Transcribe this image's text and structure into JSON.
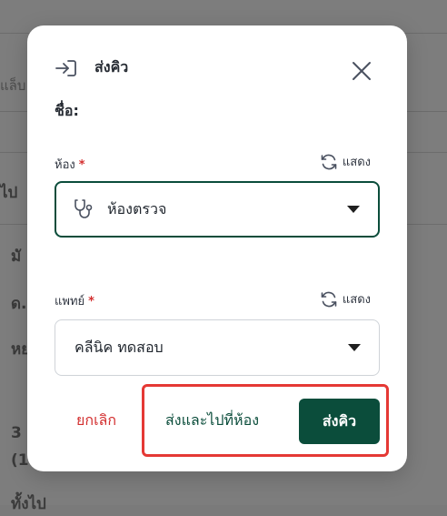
{
  "background": {
    "fragments": [
      "แล็บ",
      "ไป",
      "มั",
      "ด.",
      "หย",
      "3",
      "(1",
      "ทั้งไป"
    ]
  },
  "modal": {
    "title": "ส่งคิว",
    "name_label": "ชื่อ:",
    "room": {
      "label": "ห้อง",
      "required_mark": "*",
      "show_label": "แสดง",
      "value": "ห้องตรวจ"
    },
    "doctor": {
      "label": "แพทย์",
      "required_mark": "*",
      "show_label": "แสดง",
      "value": "คลีนิค ทดสอบ"
    },
    "actions": {
      "cancel": "ยกเลิก",
      "send_and_go": "ส่งและไปที่ห้อง",
      "send": "ส่งคิว"
    }
  },
  "colors": {
    "primary": "#0b4d3b",
    "danger": "#d32f2f",
    "highlight": "#e53935"
  },
  "icons": {
    "header": "send-queue-icon",
    "close": "close-icon",
    "refresh": "refresh-icon",
    "room": "stethoscope-icon",
    "dropdown": "caret-down-icon"
  }
}
